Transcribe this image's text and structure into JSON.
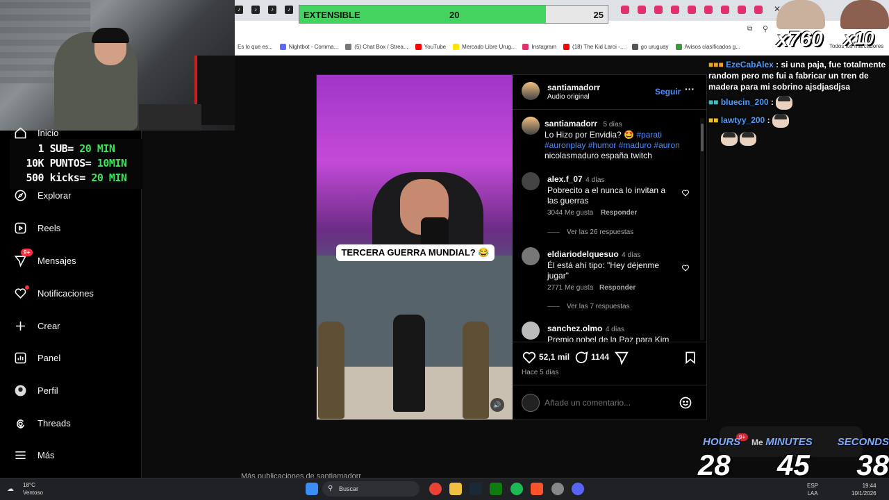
{
  "browser": {
    "bookmarks": [
      {
        "label": "Es lo que es...",
        "color": "#999"
      },
      {
        "label": "Nightbot - Comma...",
        "color": "#5a6aff"
      },
      {
        "label": "(5) Chat Box / Strea...",
        "color": "#777"
      },
      {
        "label": "YouTube",
        "color": "#ff0000"
      },
      {
        "label": "Mercado Libre Urug...",
        "color": "#ffe600"
      },
      {
        "label": "Instagram",
        "color": "#e1306c"
      },
      {
        "label": "(18) The Kid Laroi -...",
        "color": "#ff0000"
      },
      {
        "label": "go uruguay",
        "color": "#555"
      },
      {
        "label": "Avisos clasificados g...",
        "color": "#3c9a3c"
      }
    ],
    "all_bookmarks": "Todos los marcadores"
  },
  "extensible": {
    "label": "EXTENSIBLE",
    "current": "20",
    "goal": "25",
    "progress": 0.8
  },
  "overlay": {
    "rules": [
      {
        "prefix": "1 SUB= ",
        "value": "20 MIN"
      },
      {
        "prefix": "10K PUNTOS= ",
        "value": "10MIN"
      },
      {
        "prefix": "500 kicks= ",
        "value": "20 MIN"
      }
    ],
    "multiplier_left": "x760",
    "multiplier_right": "x10"
  },
  "sidebar": {
    "items": [
      {
        "label": "Inicio",
        "icon": "home-icon"
      },
      {
        "label": "Explorar",
        "icon": "compass-icon"
      },
      {
        "label": "Reels",
        "icon": "reels-icon"
      },
      {
        "label": "Mensajes",
        "icon": "messenger-icon",
        "badge": "9+"
      },
      {
        "label": "Notificaciones",
        "icon": "heart-icon"
      },
      {
        "label": "Crear",
        "icon": "plus-icon"
      },
      {
        "label": "Panel",
        "icon": "dashboard-icon"
      },
      {
        "label": "Perfil",
        "icon": "profile-icon"
      },
      {
        "label": "Threads",
        "icon": "threads-icon"
      },
      {
        "label": "Más",
        "icon": "menu-icon"
      }
    ]
  },
  "post": {
    "author": "santiamadorr",
    "audio": "Audio original",
    "follow": "Seguir",
    "video_caption": "TERCERA GUERRA MUNDIAL? 😂",
    "caption": {
      "user": "santiamadorr",
      "time": "5 días",
      "text": "Lo Hizo por Envidia? 🤩",
      "tags": "#parati #auronplay #humor #maduro #auron",
      "rest": "nicolasmaduro españa twitch"
    },
    "comments": [
      {
        "user": "alex.f_07",
        "time": "4 días",
        "text": "Pobrecito a el nunca lo invitan a las guerras",
        "likes": "3044 Me gusta",
        "reply": "Responder",
        "view_replies": "Ver las 26 respuestas"
      },
      {
        "user": "eldiariodelquesuo",
        "time": "4 días",
        "text": "Él está ahí tipo: \"Hey déjenme jugar\"",
        "likes": "2771 Me gusta",
        "reply": "Responder",
        "view_replies": "Ver las 7 respuestas"
      },
      {
        "user": "sanchez.olmo",
        "time": "4 días",
        "text": "Premio nobel de la Paz para Kim"
      }
    ],
    "likes_count": "52,1 mil",
    "comments_count": "1144",
    "posted": "Hace 5 días",
    "add_comment_placeholder": "Añade un comentario...",
    "more_posts": "Más publicaciones de santiamadorr"
  },
  "chat": [
    {
      "user": "EzeCabAlex",
      "text": ": si una paja, fue totalmente random pero me fui a fabricar un tren de madera para mi sobrino ajsdjasdjsa"
    },
    {
      "user": "bluecin_200",
      "text": ":"
    },
    {
      "user": "lawtyy_200",
      "text": ":"
    }
  ],
  "timer": {
    "labels": [
      "HOURS",
      "MINUTES",
      "SECONDS"
    ],
    "hours": "28",
    "minutes": "45",
    "seconds": "38",
    "mensajes_overlay": "Me",
    "badge": "9+"
  },
  "taskbar": {
    "weather_temp": "18°C",
    "weather_desc": "Ventoso",
    "search": "Buscar",
    "lang1": "ESP",
    "lang2": "LAA",
    "time": "19:44",
    "date": "10/1/2026"
  }
}
